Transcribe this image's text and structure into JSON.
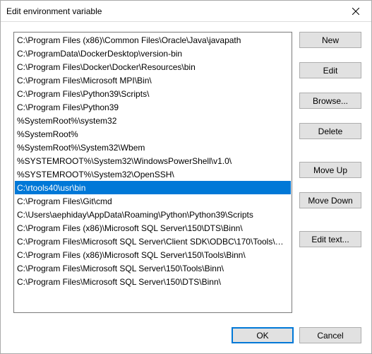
{
  "window": {
    "title": "Edit environment variable"
  },
  "items": [
    {
      "text": "C:\\Program Files (x86)\\Common Files\\Oracle\\Java\\javapath",
      "selected": false
    },
    {
      "text": "C:\\ProgramData\\DockerDesktop\\version-bin",
      "selected": false
    },
    {
      "text": "C:\\Program Files\\Docker\\Docker\\Resources\\bin",
      "selected": false
    },
    {
      "text": "C:\\Program Files\\Microsoft MPI\\Bin\\",
      "selected": false
    },
    {
      "text": "C:\\Program Files\\Python39\\Scripts\\",
      "selected": false
    },
    {
      "text": "C:\\Program Files\\Python39",
      "selected": false
    },
    {
      "text": "%SystemRoot%\\system32",
      "selected": false
    },
    {
      "text": "%SystemRoot%",
      "selected": false
    },
    {
      "text": "%SystemRoot%\\System32\\Wbem",
      "selected": false
    },
    {
      "text": "%SYSTEMROOT%\\System32\\WindowsPowerShell\\v1.0\\",
      "selected": false
    },
    {
      "text": "%SYSTEMROOT%\\System32\\OpenSSH\\",
      "selected": false
    },
    {
      "text": "C:\\rtools40\\usr\\bin",
      "selected": true
    },
    {
      "text": "C:\\Program Files\\Git\\cmd",
      "selected": false
    },
    {
      "text": "C:\\Users\\aephiday\\AppData\\Roaming\\Python\\Python39\\Scripts",
      "selected": false
    },
    {
      "text": "C:\\Program Files (x86)\\Microsoft SQL Server\\150\\DTS\\Binn\\",
      "selected": false
    },
    {
      "text": "C:\\Program Files\\Microsoft SQL Server\\Client SDK\\ODBC\\170\\Tools\\Bi...",
      "selected": false
    },
    {
      "text": "C:\\Program Files (x86)\\Microsoft SQL Server\\150\\Tools\\Binn\\",
      "selected": false
    },
    {
      "text": "C:\\Program Files\\Microsoft SQL Server\\150\\Tools\\Binn\\",
      "selected": false
    },
    {
      "text": "C:\\Program Files\\Microsoft SQL Server\\150\\DTS\\Binn\\",
      "selected": false
    }
  ],
  "buttons": {
    "new": "New",
    "edit": "Edit",
    "browse": "Browse...",
    "delete": "Delete",
    "moveup": "Move Up",
    "movedown": "Move Down",
    "edittext": "Edit text...",
    "ok": "OK",
    "cancel": "Cancel"
  }
}
